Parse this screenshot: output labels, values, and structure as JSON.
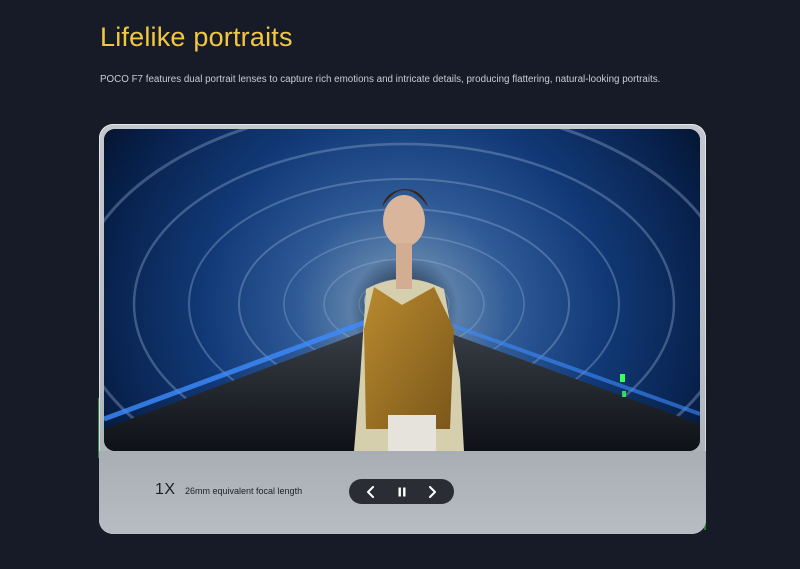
{
  "section": {
    "title": "Lifelike portraits",
    "description": "POCO F7 features dual portrait lenses to capture rich emotions and intricate details, producing flattering, natural-looking portraits."
  },
  "slide": {
    "zoom_label": "1X",
    "focal_label": "26mm equivalent focal length"
  },
  "controls": {
    "prev_icon": "chevron-left-icon",
    "pause_icon": "pause-icon",
    "next_icon": "chevron-right-icon"
  },
  "colors": {
    "accent": "#f2c840",
    "background": "#171b27",
    "deco_green": "#38b84a",
    "control_bg": "#2a2d33"
  }
}
